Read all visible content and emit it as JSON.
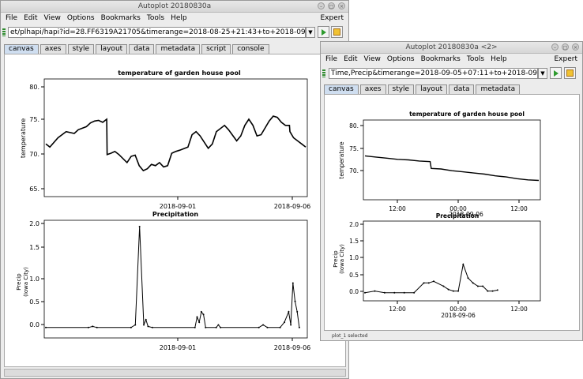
{
  "win1": {
    "title": "Autoplot 20180830a",
    "menus": [
      "File",
      "Edit",
      "View",
      "Options",
      "Bookmarks",
      "Tools",
      "Help"
    ],
    "menu_right": "Expert",
    "url": "et/plhapi/hapi?id=28.FF6319A21705&timerange=2018-08-25+21:43+to+2018-09-06+04:46",
    "tabs": [
      "canvas",
      "axes",
      "style",
      "layout",
      "data",
      "metadata",
      "script",
      "console"
    ],
    "plot1": {
      "title": "temperature of garden house pool",
      "ylabel": "temperature",
      "yticks": [
        "80.",
        "75.",
        "70.",
        "65."
      ],
      "xticks": [
        "2018-09-01",
        "2018-09-06"
      ]
    },
    "plot2": {
      "title": "Precipitation",
      "ylabel1": "Precip",
      "ylabel2": "(Iowa City)",
      "yticks": [
        "2.0",
        "1.5",
        "1.0",
        "0.5",
        "0.0"
      ],
      "xticks": [
        "2018-09-01",
        "2018-09-06"
      ]
    }
  },
  "win2": {
    "title": "Autoplot 20180830a <2>",
    "menus": [
      "File",
      "Edit",
      "View",
      "Options",
      "Bookmarks",
      "Tools",
      "Help"
    ],
    "menu_right": "Expert",
    "url": "Time,Precip&timerange=2018-09-05+07:11+to+2018-09-07+07:",
    "tabs": [
      "canvas",
      "axes",
      "style",
      "layout",
      "data",
      "metadata"
    ],
    "plot1": {
      "title": "temperature of garden house pool",
      "ylabel": "temperature",
      "yticks": [
        "80.",
        "75.",
        "70."
      ],
      "xticks": [
        "12:00",
        "00:00",
        "12:00"
      ],
      "xsub": "2018-09-06"
    },
    "plot2": {
      "title": "Precipitation",
      "ylabel1": "Precip",
      "ylabel2": "(Iowa City)",
      "yticks": [
        "2.0",
        "1.5",
        "1.0",
        "0.5",
        "0.0"
      ],
      "xticks": [
        "12:00",
        "00:00",
        "12:00"
      ],
      "xsub": "2018-09-06"
    },
    "status": "plot_1 selected"
  },
  "series": {
    "temp_full": [
      [
        0,
        71.5
      ],
      [
        1,
        71
      ],
      [
        3,
        72.5
      ],
      [
        5,
        73.5
      ],
      [
        7,
        73.2
      ],
      [
        8,
        73.8
      ],
      [
        10,
        74.3
      ],
      [
        11,
        74.9
      ],
      [
        12,
        75.2
      ],
      [
        13,
        75.3
      ],
      [
        14,
        75
      ],
      [
        15,
        75.5
      ],
      [
        15.1,
        69.8
      ],
      [
        16,
        70
      ],
      [
        17,
        70.3
      ],
      [
        18,
        69.8
      ],
      [
        20,
        68.5
      ],
      [
        21,
        69.5
      ],
      [
        22,
        69.7
      ],
      [
        23,
        68
      ],
      [
        24,
        67.2
      ],
      [
        25,
        67.5
      ],
      [
        26,
        68.2
      ],
      [
        27,
        68
      ],
      [
        28,
        68.5
      ],
      [
        29,
        67.8
      ],
      [
        30,
        68
      ],
      [
        31,
        70
      ],
      [
        32,
        70.3
      ],
      [
        33,
        70.5
      ],
      [
        35,
        71
      ],
      [
        36,
        73
      ],
      [
        37,
        73.5
      ],
      [
        38,
        72.8
      ],
      [
        40,
        70.8
      ],
      [
        41,
        71.5
      ],
      [
        42,
        73.5
      ],
      [
        44,
        74.5
      ],
      [
        45,
        73.8
      ],
      [
        47,
        72
      ],
      [
        48,
        72.8
      ],
      [
        49,
        74.5
      ],
      [
        50,
        75.5
      ],
      [
        51,
        74.5
      ],
      [
        52,
        72.8
      ],
      [
        53,
        73
      ],
      [
        55,
        75.2
      ],
      [
        56,
        76
      ],
      [
        57,
        75.8
      ],
      [
        58,
        75
      ],
      [
        59,
        74.5
      ],
      [
        60,
        74.5
      ],
      [
        60.1,
        73.5
      ],
      [
        61,
        72.5
      ],
      [
        62,
        72
      ],
      [
        63,
        71.5
      ],
      [
        64,
        71
      ]
    ],
    "precip_full": [
      [
        0,
        0
      ],
      [
        10,
        0
      ],
      [
        11,
        0.02
      ],
      [
        12,
        0
      ],
      [
        20,
        0
      ],
      [
        21,
        0.05
      ],
      [
        22,
        1.93
      ],
      [
        23,
        0.05
      ],
      [
        23.5,
        0.15
      ],
      [
        24,
        0.02
      ],
      [
        25,
        0
      ],
      [
        35,
        0
      ],
      [
        35.5,
        0.2
      ],
      [
        36,
        0.1
      ],
      [
        36.5,
        0.3
      ],
      [
        37,
        0.25
      ],
      [
        37.5,
        0
      ],
      [
        40,
        0
      ],
      [
        40.5,
        0.05
      ],
      [
        41,
        0
      ],
      [
        50,
        0
      ],
      [
        51,
        0.05
      ],
      [
        52,
        0
      ],
      [
        55,
        0
      ],
      [
        56,
        0.1
      ],
      [
        57,
        0.3
      ],
      [
        57.5,
        0.05
      ],
      [
        58,
        0.85
      ],
      [
        58.5,
        0.5
      ],
      [
        59,
        0.3
      ],
      [
        59.5,
        0
      ]
    ],
    "temp_zoom": [
      [
        0,
        75.2
      ],
      [
        1,
        75
      ],
      [
        2,
        74.8
      ],
      [
        3,
        74.6
      ],
      [
        4,
        74.5
      ],
      [
        5,
        74.3
      ],
      [
        6,
        74.2
      ],
      [
        6.1,
        73
      ],
      [
        7,
        72.9
      ],
      [
        8,
        72.6
      ],
      [
        9,
        72.4
      ],
      [
        10,
        72.2
      ],
      [
        11,
        72.0
      ],
      [
        12,
        71.7
      ],
      [
        13,
        71.5
      ],
      [
        14,
        71.2
      ],
      [
        15,
        71.0
      ],
      [
        16,
        70.9
      ]
    ],
    "precip_zoom": [
      [
        0,
        0
      ],
      [
        1,
        0.05
      ],
      [
        2,
        0
      ],
      [
        3,
        0
      ],
      [
        4,
        0
      ],
      [
        5,
        0
      ],
      [
        6,
        0.3
      ],
      [
        6.5,
        0.3
      ],
      [
        7,
        0.35
      ],
      [
        8,
        0.2
      ],
      [
        8.5,
        0.1
      ],
      [
        9,
        0.05
      ],
      [
        9.5,
        0.05
      ],
      [
        10,
        0.87
      ],
      [
        10.5,
        0.45
      ],
      [
        11,
        0.3
      ],
      [
        11.5,
        0.2
      ],
      [
        12,
        0.2
      ],
      [
        12.5,
        0.05
      ],
      [
        13,
        0.05
      ],
      [
        13.5,
        0.08
      ]
    ]
  }
}
